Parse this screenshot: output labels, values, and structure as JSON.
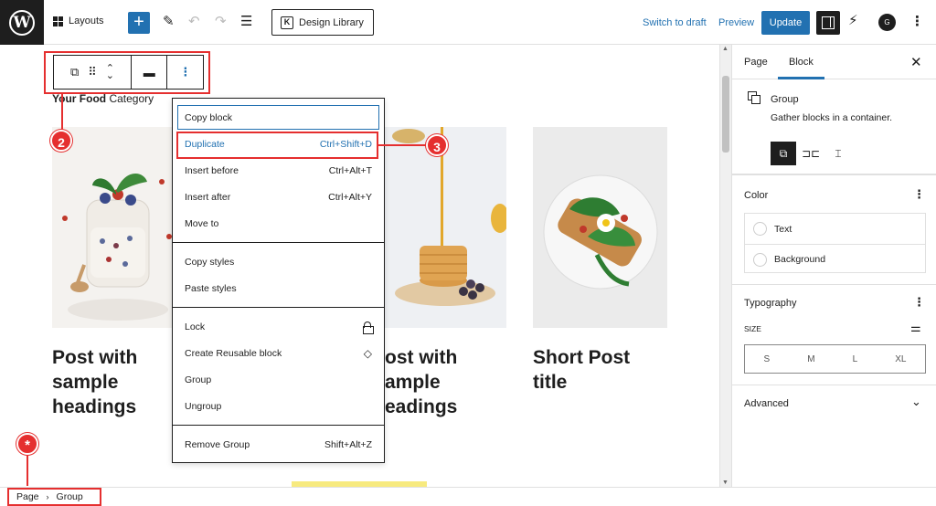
{
  "topbar": {
    "layouts_label": "Layouts",
    "design_library_label": "Design Library",
    "switch_to_draft": "Switch to draft",
    "preview": "Preview",
    "update": "Update",
    "g_badge": "G",
    "accent": "#2271b1"
  },
  "canvas": {
    "section_heading_bold": "Your Food",
    "section_heading_rest": " Category",
    "posts": [
      {
        "title": "Post with sample headings"
      },
      {
        "title": "ost with ample eadings"
      },
      {
        "title": "Short Post title"
      }
    ],
    "post_title_lines": [
      "Post with",
      "sample",
      "headings"
    ],
    "post2_title_lines": [
      "ost with",
      "ample",
      "eadings"
    ],
    "post3_title_lines": [
      "Short Post",
      "title"
    ]
  },
  "context_menu": {
    "groups": [
      [
        {
          "label": "Copy block",
          "shortcut": ""
        },
        {
          "label": "Duplicate",
          "shortcut": "Ctrl+Shift+D"
        },
        {
          "label": "Insert before",
          "shortcut": "Ctrl+Alt+T"
        },
        {
          "label": "Insert after",
          "shortcut": "Ctrl+Alt+Y"
        },
        {
          "label": "Move to",
          "shortcut": ""
        }
      ],
      [
        {
          "label": "Copy styles",
          "shortcut": ""
        },
        {
          "label": "Paste styles",
          "shortcut": ""
        }
      ],
      [
        {
          "label": "Lock",
          "shortcut": ""
        },
        {
          "label": "Create Reusable block",
          "shortcut": ""
        },
        {
          "label": "Group",
          "shortcut": ""
        },
        {
          "label": "Ungroup",
          "shortcut": ""
        }
      ],
      [
        {
          "label": "Remove Group",
          "shortcut": "Shift+Alt+Z"
        }
      ]
    ]
  },
  "annotations": {
    "marker_2": "2",
    "marker_3": "3",
    "marker_star": "*",
    "color": "#e52f2f"
  },
  "sidebar": {
    "tab_page": "Page",
    "tab_block": "Block",
    "block_title": "Group",
    "block_description": "Gather blocks in a container.",
    "color_panel_title": "Color",
    "color_text": "Text",
    "color_background": "Background",
    "typography_title": "Typography",
    "size_label": "SIZE",
    "sizes": [
      "S",
      "M",
      "L",
      "XL"
    ],
    "advanced_title": "Advanced"
  },
  "breadcrumb": {
    "page": "Page",
    "group": "Group"
  }
}
